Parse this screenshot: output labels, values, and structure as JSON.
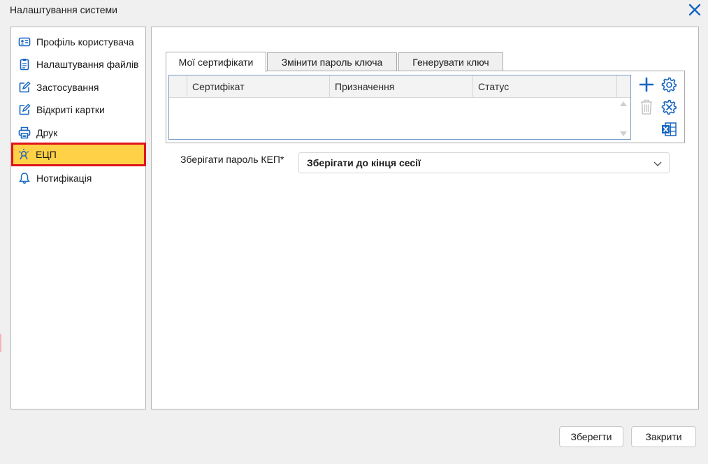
{
  "window": {
    "title": "Налаштування системи"
  },
  "sidebar": {
    "items": [
      {
        "label": "Профіль користувача",
        "icon": "user-card-icon"
      },
      {
        "label": "Налаштування файлів",
        "icon": "clipboard-icon"
      },
      {
        "label": "Застосування",
        "icon": "edit-icon"
      },
      {
        "label": "Відкриті картки",
        "icon": "edit-icon"
      },
      {
        "label": "Друк",
        "icon": "printer-icon"
      },
      {
        "label": "ЕЦП",
        "icon": "digital-signature-icon",
        "active": true
      },
      {
        "label": "Нотифікація",
        "icon": "bell-icon"
      }
    ]
  },
  "tabs": [
    {
      "label": "Мої сертифікати",
      "active": true
    },
    {
      "label": "Змінити пароль ключа"
    },
    {
      "label": "Генерувати ключ"
    }
  ],
  "grid": {
    "columns": [
      "Сертифікат",
      "Призначення",
      "Статус"
    ],
    "rows": []
  },
  "form": {
    "save_password_label": "Зберігати пароль КЕП*",
    "save_password_value": "Зберігати до кінця сесії"
  },
  "buttons": {
    "save": "Зберегти",
    "close": "Закрити"
  },
  "colors": {
    "accent": "#1565c0",
    "active_item_bg": "#ffd146",
    "active_item_border": "#e0141b"
  }
}
